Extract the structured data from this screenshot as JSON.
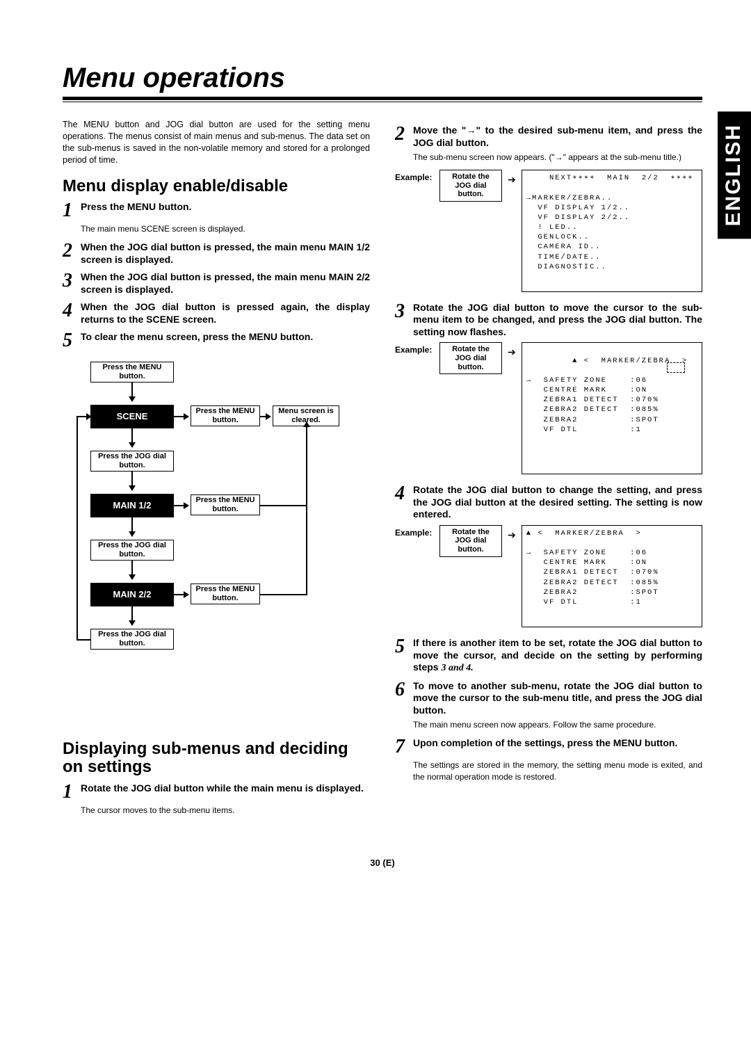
{
  "lang_tab": "ENGLISH",
  "page_title": "Menu operations",
  "intro": "The MENU button and JOG dial button are used for the setting menu operations.  The menus consist of main menus and sub-menus.  The data set on the sub-menus is saved in the non-volatile memory and stored for a prolonged period of time.",
  "section_a": "Menu display enable/disable",
  "left_steps": {
    "s1_hdr": "Press the MENU button.",
    "s1_note": "The main menu SCENE screen is displayed.",
    "s2_hdr": "When the JOG dial button is pressed, the main menu MAIN 1/2 screen is displayed.",
    "s3_hdr": "When the JOG dial button is pressed, the main menu MAIN 2/2 screen is displayed.",
    "s4_hdr": "When the JOG dial button is pressed again, the display returns to the SCENE screen.",
    "s5_hdr": "To clear the menu screen, press the MENU button."
  },
  "flow": {
    "press_menu": "Press the MENU button.",
    "press_jog": "Press the JOG dial button.",
    "scene": "SCENE",
    "main12": "MAIN 1/2",
    "main22": "MAIN 2/2",
    "cleared": "Menu screen is cleared."
  },
  "section_b": "Displaying sub-menus and deciding on settings",
  "b1_hdr": "Rotate the JOG dial button while the main menu is displayed.",
  "b1_note": "The cursor moves to the sub-menu items.",
  "right_steps": {
    "s2_hdr": "Move the \"→\" to the desired sub-menu item, and press the JOG dial button.",
    "s2_note": "The sub-menu screen now appears.  (\"→\" appears at the sub-menu title.)",
    "s3_hdr": "Rotate the JOG dial button to move the cursor to the sub-menu item to be changed, and press the JOG dial button.  The setting now flashes.",
    "s4_hdr": "Rotate the JOG dial button to change the setting, and press the JOG dial button at the desired setting.  The setting is now entered.",
    "s5_hdr": "If there is another item to be set, rotate the JOG dial button to move the cursor, and decide on the setting by performing steps ",
    "s5_em": "3 and 4.",
    "s6_hdr": "To move to another sub-menu, rotate the JOG dial button to move the cursor to the sub-menu title, and press the JOG dial button.",
    "s6_note": "The main menu screen now appears.  Follow the same procedure.",
    "s7_hdr": "Upon completion of the settings, press the MENU button.",
    "s7_note": "The settings are stored in the memory, the setting menu mode is exited, and the normal operation mode is restored."
  },
  "example_label": "Example:",
  "example_box": "Rotate the JOG dial button.",
  "screens": {
    "a": "    NEXT∗∗∗∗  MAIN  2/2  ∗∗∗∗\n\n→MARKER/ZEBRA..\n  VF DISPLAY 1/2..\n  VF DISPLAY 2/2..\n  ! LED..\n  GENLOCK..\n  CAMERA ID..\n  TIME/DATE..\n  DIAGNOSTIC..",
    "b": "▲ <  MARKER/ZEBRA  >\n\n→  SAFETY ZONE    :06\n   CENTRE MARK    :ON\n   ZEBRA1 DETECT  :070%\n   ZEBRA2 DETECT  :085%\n   ZEBRA2         :SPOT\n   VF DTL         :1",
    "c": "▲ <  MARKER/ZEBRA  >\n\n→  SAFETY ZONE    :06\n   CENTRE MARK    :ON\n   ZEBRA1 DETECT  :070%\n   ZEBRA2 DETECT  :085%\n   ZEBRA2         :SPOT\n   VF DTL         :1"
  },
  "page_num": "30 (E)"
}
